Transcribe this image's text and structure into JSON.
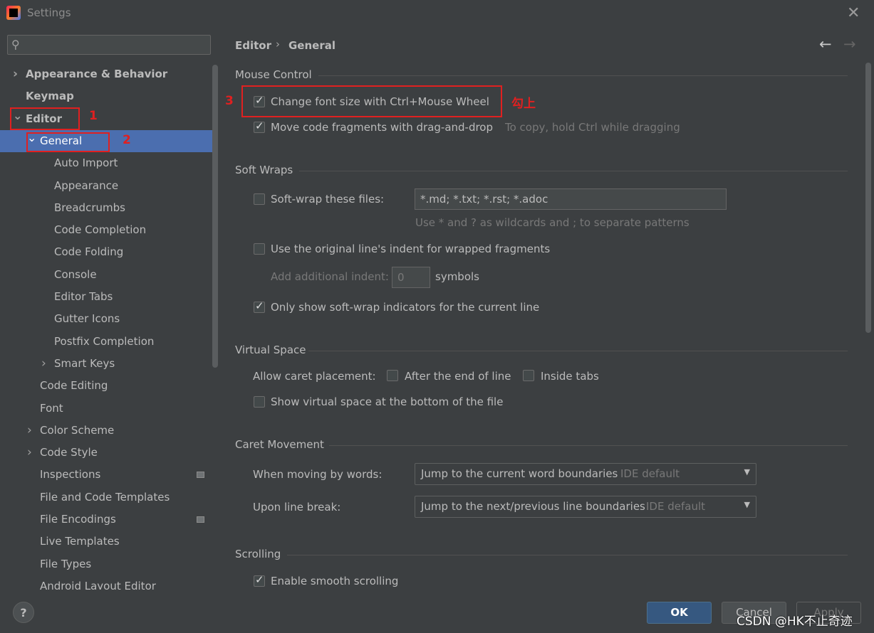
{
  "window": {
    "title": "Settings"
  },
  "search": {
    "placeholder": ""
  },
  "sidebar": {
    "items": [
      {
        "label": "Appearance & Behavior",
        "level": 0,
        "chevron": "right",
        "bold": true
      },
      {
        "label": "Keymap",
        "level": 0,
        "chevron": "none",
        "bold": true
      },
      {
        "label": "Editor",
        "level": 0,
        "chevron": "down",
        "bold": true
      },
      {
        "label": "General",
        "level": 1,
        "chevron": "down",
        "selected": true
      },
      {
        "label": "Auto Import",
        "level": 2,
        "chevron": "none"
      },
      {
        "label": "Appearance",
        "level": 2,
        "chevron": "none"
      },
      {
        "label": "Breadcrumbs",
        "level": 2,
        "chevron": "none"
      },
      {
        "label": "Code Completion",
        "level": 2,
        "chevron": "none"
      },
      {
        "label": "Code Folding",
        "level": 2,
        "chevron": "none"
      },
      {
        "label": "Console",
        "level": 2,
        "chevron": "none"
      },
      {
        "label": "Editor Tabs",
        "level": 2,
        "chevron": "none"
      },
      {
        "label": "Gutter Icons",
        "level": 2,
        "chevron": "none"
      },
      {
        "label": "Postfix Completion",
        "level": 2,
        "chevron": "none"
      },
      {
        "label": "Smart Keys",
        "level": 2,
        "chevron": "right"
      },
      {
        "label": "Code Editing",
        "level": 1,
        "chevron": "none"
      },
      {
        "label": "Font",
        "level": 1,
        "chevron": "none"
      },
      {
        "label": "Color Scheme",
        "level": 1,
        "chevron": "right"
      },
      {
        "label": "Code Style",
        "level": 1,
        "chevron": "right"
      },
      {
        "label": "Inspections",
        "level": 1,
        "chevron": "none",
        "project_icon": true
      },
      {
        "label": "File and Code Templates",
        "level": 1,
        "chevron": "none"
      },
      {
        "label": "File Encodings",
        "level": 1,
        "chevron": "none",
        "project_icon": true
      },
      {
        "label": "Live Templates",
        "level": 1,
        "chevron": "none"
      },
      {
        "label": "File Types",
        "level": 1,
        "chevron": "none"
      },
      {
        "label": "Android Layout Editor",
        "level": 1,
        "chevron": "none"
      }
    ]
  },
  "annotations": {
    "n1": "1",
    "n2": "2",
    "n3": "3",
    "note3": "勾上",
    "color": "#e02020"
  },
  "breadcrumb": {
    "editor": "Editor",
    "separator": "›",
    "general": "General"
  },
  "nav": {
    "back": "←",
    "forward": "→"
  },
  "mouse_control": {
    "title": "Mouse Control",
    "font_size_label": "Change font size with Ctrl+Mouse Wheel",
    "font_size_checked": true,
    "drag_label": "Move code fragments with drag-and-drop",
    "drag_checked": true,
    "drag_hint": "To copy, hold Ctrl while dragging"
  },
  "soft_wraps": {
    "title": "Soft Wraps",
    "softwrap_label": "Soft-wrap these files:",
    "softwrap_checked": false,
    "patterns_value": "*.md; *.txt; *.rst; *.adoc",
    "patterns_hint": "Use * and ? as wildcards and ; to separate patterns",
    "indent_label": "Use the original line's indent for wrapped fragments",
    "indent_checked": false,
    "additional_indent_label": "Add additional indent:",
    "additional_indent_value": "0",
    "symbols_label": "symbols",
    "indicators_label": "Only show soft-wrap indicators for the current line",
    "indicators_checked": true
  },
  "virtual_space": {
    "title": "Virtual Space",
    "caret_label": "Allow caret placement:",
    "after_end_label": "After the end of line",
    "inside_tabs_label": "Inside tabs",
    "show_virtual_label": "Show virtual space at the bottom of the file"
  },
  "caret_movement": {
    "title": "Caret Movement",
    "words_label": "When moving by words:",
    "words_value": "Jump to the current word boundaries",
    "words_default": "IDE default",
    "line_break_label": "Upon line break:",
    "line_break_value": "Jump to the next/previous line boundaries",
    "line_break_default": "IDE default"
  },
  "scrolling": {
    "title": "Scrolling",
    "smooth_label": "Enable smooth scrolling",
    "smooth_checked": true
  },
  "footer": {
    "help": "?",
    "ok": "OK",
    "cancel": "Cancel",
    "apply": "Apply",
    "watermark": "CSDN @HK不止奇迹"
  }
}
